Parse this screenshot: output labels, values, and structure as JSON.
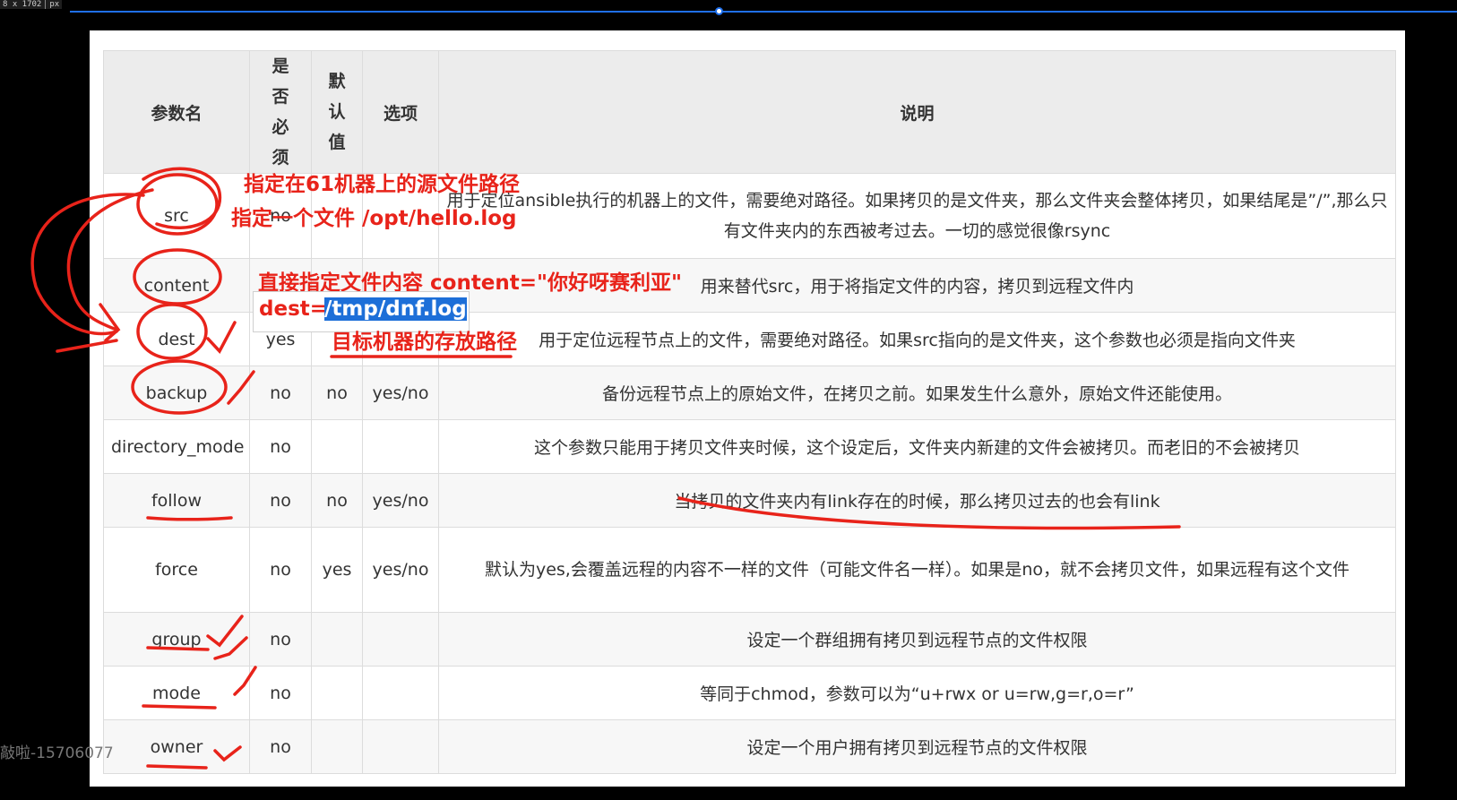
{
  "ruler": {
    "size": "8 x 1702",
    "unit": "px"
  },
  "watermark": "敲啦-15706077",
  "table": {
    "headers": [
      "参数名",
      "是否必须",
      "默认值",
      "选项",
      "说明"
    ],
    "rows": [
      {
        "name": "src",
        "required": "no",
        "default": "",
        "options": "",
        "desc": "用于定位ansible执行的机器上的文件，需要绝对路径。如果拷贝的是文件夹，那么文件夹会整体拷贝，如果结尾是”/”,那么只有文件夹内的东西被考过去。一切的感觉很像rsync"
      },
      {
        "name": "content",
        "required": "",
        "default": "",
        "options": "",
        "desc": "用来替代src，用于将指定文件的内容，拷贝到远程文件内"
      },
      {
        "name": "dest",
        "required": "yes",
        "default": "",
        "options": "",
        "desc": "用于定位远程节点上的文件，需要绝对路径。如果src指向的是文件夹，这个参数也必须是指向文件夹"
      },
      {
        "name": "backup",
        "required": "no",
        "default": "no",
        "options": "yes/no",
        "desc": "备份远程节点上的原始文件，在拷贝之前。如果发生什么意外，原始文件还能使用。"
      },
      {
        "name": "directory_mode",
        "required": "no",
        "default": "",
        "options": "",
        "desc": "这个参数只能用于拷贝文件夹时候，这个设定后，文件夹内新建的文件会被拷贝。而老旧的不会被拷贝"
      },
      {
        "name": "follow",
        "required": "no",
        "default": "no",
        "options": "yes/no",
        "desc": "当拷贝的文件夹内有link存在的时候，那么拷贝过去的也会有link"
      },
      {
        "name": "force",
        "required": "no",
        "default": "yes",
        "options": "yes/no",
        "desc": "默认为yes,会覆盖远程的内容不一样的文件（可能文件名一样）。如果是no，就不会拷贝文件，如果远程有这个文件"
      },
      {
        "name": "group",
        "required": "no",
        "default": "",
        "options": "",
        "desc": "设定一个群组拥有拷贝到远程节点的文件权限"
      },
      {
        "name": "mode",
        "required": "no",
        "default": "",
        "options": "",
        "desc": "等同于chmod，参数可以为“u+rwx or u=rw,g=r,o=r”"
      },
      {
        "name": "owner",
        "required": "no",
        "default": "",
        "options": "",
        "desc": "设定一个用户拥有拷贝到远程节点的文件权限"
      }
    ]
  },
  "annotations": {
    "src_line1": "指定在61机器上的源文件路径",
    "src_line2": "指定一个文件  /opt/hello.log",
    "content": "直接指定文件内容  content=\"你好呀赛利亚\"",
    "dest_prefix": "dest=",
    "dest_value": "/tmp/dnf.log",
    "dest_note": "目标机器的存放路径"
  },
  "colors": {
    "annotation": "#e8231a",
    "highlight": "#1d6fd8",
    "guide": "#1f6feb"
  }
}
